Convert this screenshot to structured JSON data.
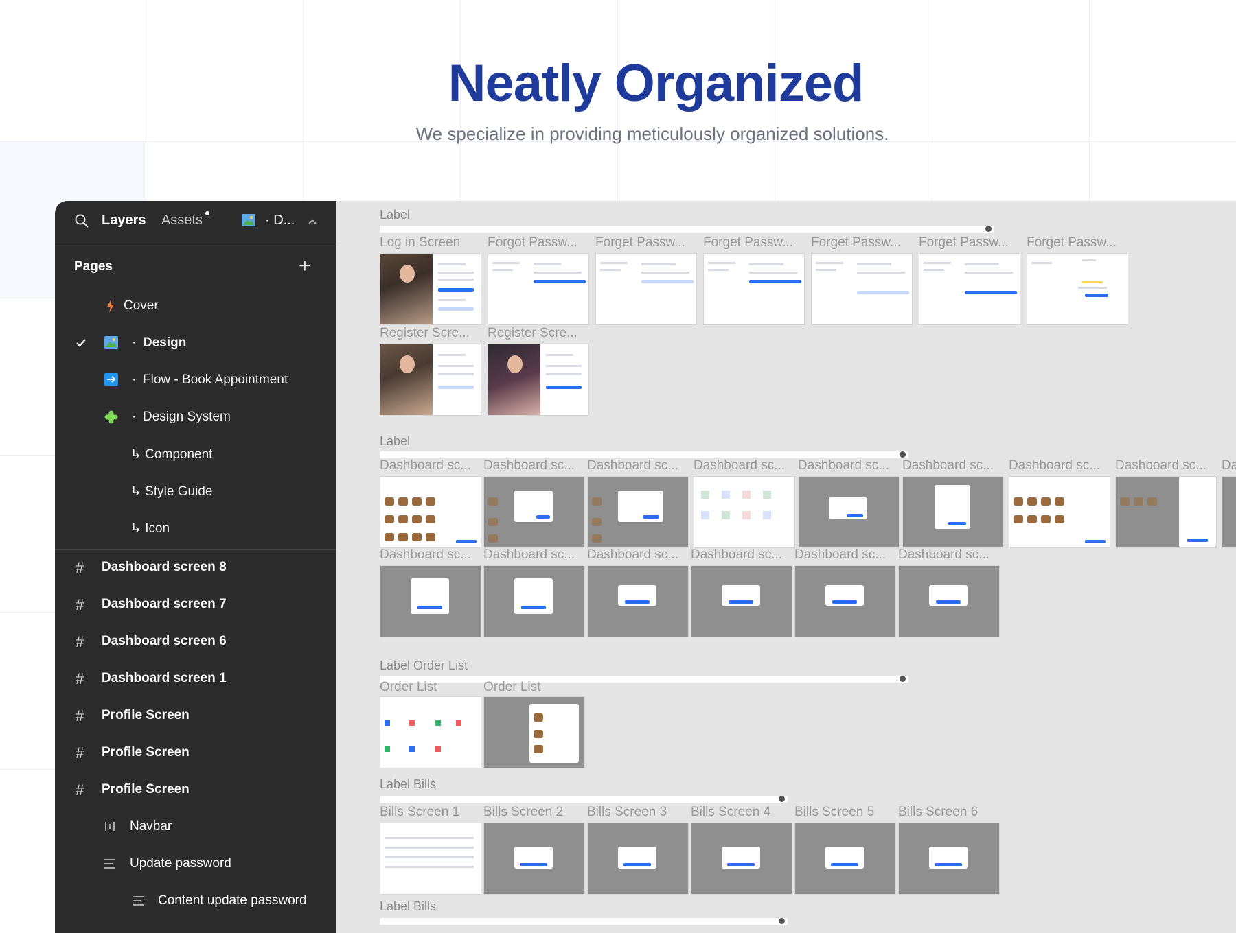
{
  "hero": {
    "title": "Neatly Organized",
    "subtitle": "We specialize in providing meticulously organized solutions."
  },
  "sidebar": {
    "tabs": {
      "layers": "Layers",
      "assets": "Assets"
    },
    "page_selector": "D...",
    "pages_title": "Pages",
    "pages": [
      {
        "label": "Cover",
        "icon": "flame-icon"
      },
      {
        "label": "Design",
        "icon": "image-icon",
        "selected": true
      },
      {
        "label": "Flow - Book Appointment",
        "icon": "arrow-right-icon"
      },
      {
        "label": "Design System",
        "icon": "puzzle-icon"
      },
      {
        "label": "↳ Component"
      },
      {
        "label": "↳ Style Guide"
      },
      {
        "label": "↳ Icon"
      }
    ],
    "layers": [
      {
        "label": "Dashboard screen 8",
        "icon": "frame-icon"
      },
      {
        "label": "Dashboard screen 7",
        "icon": "frame-icon"
      },
      {
        "label": "Dashboard screen 6",
        "icon": "frame-icon"
      },
      {
        "label": "Dashboard screen 1",
        "icon": "frame-icon"
      },
      {
        "label": "Profile Screen",
        "icon": "frame-icon"
      },
      {
        "label": "Profile Screen",
        "icon": "frame-icon"
      },
      {
        "label": "Profile Screen",
        "icon": "frame-icon"
      },
      {
        "label": "Navbar",
        "icon": "columns-icon"
      },
      {
        "label": "Update password",
        "icon": "rows-icon"
      },
      {
        "label": "Content update password",
        "icon": "rows-icon"
      }
    ]
  },
  "canvas": {
    "sections": [
      {
        "label": "Label",
        "frames_row1": [
          "Log in Screen",
          "Forgot Passw...",
          "Forget Passw...",
          "Forget Passw...",
          "Forget Passw...",
          "Forget Passw...",
          "Forget Passw..."
        ],
        "frames_row2": [
          "Register Scre...",
          "Register Scre..."
        ]
      },
      {
        "label": "Label",
        "frames_row1": [
          "Dashboard sc...",
          "Dashboard sc...",
          "Dashboard sc...",
          "Dashboard sc...",
          "Dashboard sc...",
          "Dashboard sc...",
          "Dashboard sc...",
          "Dashboard sc...",
          "Da"
        ],
        "frames_row2": [
          "Dashboard sc...",
          "Dashboard sc...",
          "Dashboard sc...",
          "Dashboard sc...",
          "Dashboard sc...",
          "Dashboard sc..."
        ]
      },
      {
        "label": "Label Order List",
        "frames_row1": [
          "Order List",
          "Order List"
        ]
      },
      {
        "label": "Label Bills",
        "frames_row1": [
          "Bills Screen 1",
          "Bills Screen 2",
          "Bills Screen 3",
          "Bills Screen 4",
          "Bills Screen 5",
          "Bills Screen 6"
        ]
      },
      {
        "label": "Label Bills"
      }
    ]
  },
  "colors": {
    "hero_title": "#1e3a9a",
    "sidebar_bg": "#2c2c2c",
    "canvas_bg": "#e4e4e4",
    "accent": "#2c6ef2"
  }
}
